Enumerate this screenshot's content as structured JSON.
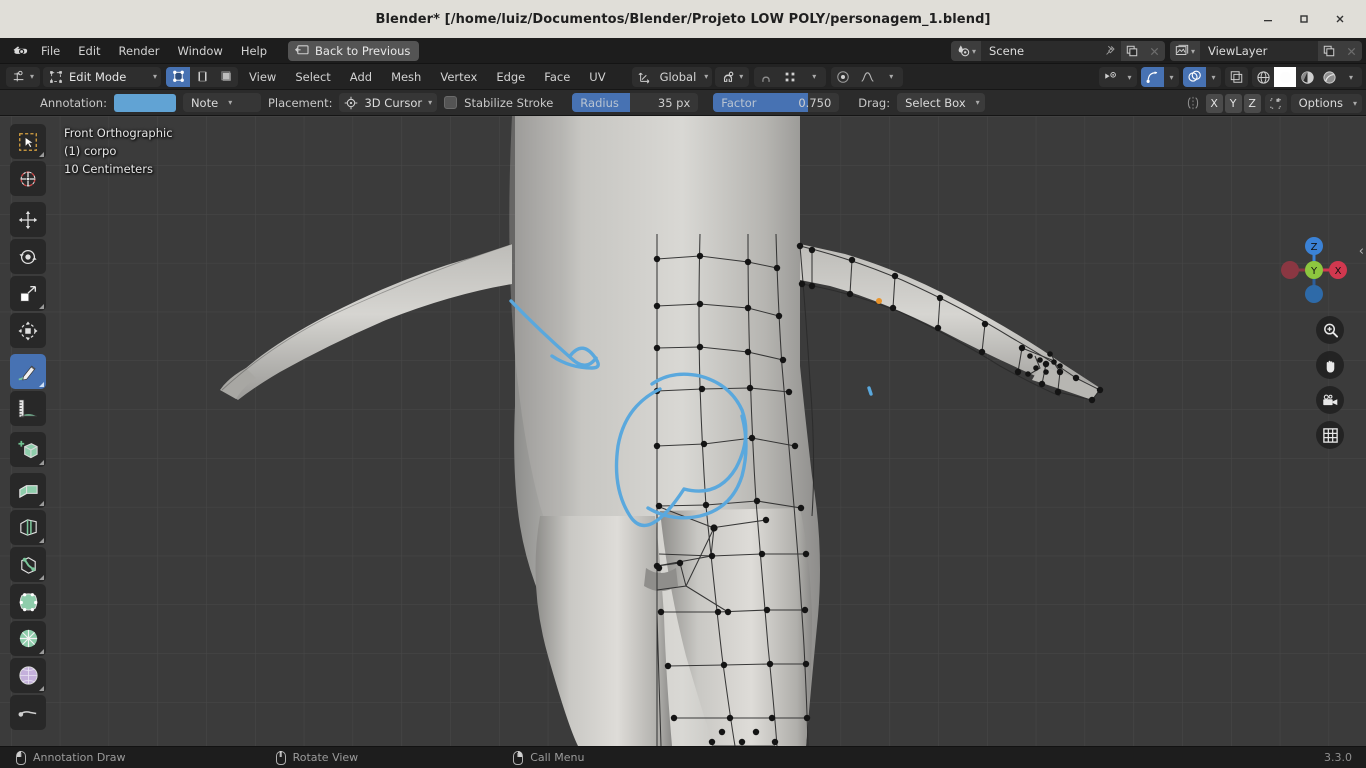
{
  "window": {
    "title": "Blender* [/home/luiz/Documentos/Blender/Projeto LOW POLY/personagem_1.blend]",
    "minimize": "–",
    "maximize": "□",
    "close": "✕"
  },
  "topbar": {
    "logo_icon": "blender-logo-icon",
    "menus": [
      "File",
      "Edit",
      "Render",
      "Window",
      "Help"
    ],
    "back_to_previous": "Back to Previous",
    "back_icon": "back-to-previous-icon",
    "scene": {
      "icon": "scene-datablock-icon",
      "name": "Scene",
      "pin_icon": "pin-icon",
      "copy_icon": "new-scene-icon",
      "close_icon": "unlink-scene-icon"
    },
    "viewlayer": {
      "icon": "viewlayer-datablock-icon",
      "name": "ViewLayer",
      "copy_icon": "new-viewlayer-icon",
      "close_icon": "remove-viewlayer-icon"
    }
  },
  "viewheader": {
    "editor_type_icon": "editor-type-icon",
    "mode": "Edit Mode",
    "mode_icon": "edit-mode-icon",
    "select_modes": [
      "vertex-select-icon",
      "edge-select-icon",
      "face-select-icon"
    ],
    "active_select_mode": 0,
    "menus": [
      "View",
      "Select",
      "Add",
      "Mesh",
      "Vertex",
      "Edge",
      "Face",
      "UV"
    ],
    "transform_orientation": "Global",
    "transform_orientation_icon": "orientation-gizmo-icon",
    "snap_icon": "snap-magnet-icon",
    "snap_target_icon": "snap-increment-icon",
    "proportional_icon": "proportional-editing-icon",
    "falloff_icon": "proportional-falloff-icon",
    "visibility_icon": "object-visibility-icon",
    "gizmo_icon": "show-gizmo-icon",
    "overlays_icon": "show-overlays-icon",
    "xray_icon": "toggle-xray-icon",
    "shading_modes": [
      "wireframe-shading-icon",
      "solid-shading-icon",
      "material-preview-icon",
      "rendered-shading-icon"
    ],
    "active_shading": 1
  },
  "toolsettings": {
    "annotation_label": "Annotation:",
    "annotation_color": "#61a3d4",
    "layer_name": "Note",
    "placement_label": "Placement:",
    "placement_icon": "3d-cursor-icon",
    "placement_value": "3D Cursor",
    "stabilize_label": "Stabilize Stroke",
    "stabilize_checked": false,
    "radius_label": "Radius",
    "radius_value": "35 px",
    "radius_fill_pct": 46,
    "factor_label": "Factor",
    "factor_value": "0.750",
    "factor_fill_pct": 75,
    "drag_label": "Drag:",
    "drag_value": "Select Box",
    "mirror_icon": "mirror-icon",
    "axes": [
      "X",
      "Y",
      "Z"
    ],
    "snap_view_icon": "snap-to-view-icon",
    "options": "Options"
  },
  "viewport": {
    "view_name": "Front Orthographic",
    "collection_object": "(1) corpo",
    "grid_scale": "10 Centimeters",
    "background_color": "#3b3b3b",
    "annotation_stroke_color": "#5aa8dd",
    "toolbar": [
      {
        "name": "tweak-select-box-tool",
        "icon": "select-box-icon",
        "active": false,
        "group": 0
      },
      {
        "name": "cursor-tool",
        "icon": "3d-cursor-tool-icon",
        "active": false,
        "group": 0
      },
      {
        "name": "move-tool",
        "icon": "move-tool-icon",
        "active": false,
        "group": 1
      },
      {
        "name": "rotate-tool",
        "icon": "rotate-tool-icon",
        "active": false,
        "group": 1
      },
      {
        "name": "scale-tool",
        "icon": "scale-tool-icon",
        "active": false,
        "group": 1
      },
      {
        "name": "transform-tool",
        "icon": "transform-tool-icon",
        "active": false,
        "group": 1
      },
      {
        "name": "annotate-tool",
        "icon": "annotate-pencil-icon",
        "active": true,
        "group": 2
      },
      {
        "name": "measure-tool",
        "icon": "measure-ruler-icon",
        "active": false,
        "group": 2
      },
      {
        "name": "add-cube-tool",
        "icon": "add-cube-icon",
        "active": false,
        "group": 3
      },
      {
        "name": "extrude-region-tool",
        "icon": "extrude-region-icon",
        "active": false,
        "group": 4
      },
      {
        "name": "inset-faces-tool",
        "icon": "inset-faces-icon",
        "active": false,
        "group": 4
      },
      {
        "name": "bevel-tool",
        "icon": "bevel-icon",
        "active": false,
        "group": 4
      },
      {
        "name": "loop-cut-tool",
        "icon": "loop-cut-icon",
        "active": false,
        "group": 4
      },
      {
        "name": "knife-tool",
        "icon": "knife-icon",
        "active": false,
        "group": 4
      },
      {
        "name": "poly-build-tool",
        "icon": "poly-build-icon",
        "active": false,
        "group": 5
      },
      {
        "name": "spin-tool",
        "icon": "spin-icon",
        "active": false,
        "group": 5
      },
      {
        "name": "smooth-tool",
        "icon": "smooth-sphere-icon",
        "active": false,
        "group": 6
      },
      {
        "name": "shrink-fatten-tool",
        "icon": "shrink-fatten-icon",
        "active": false,
        "group": 6
      }
    ],
    "gizmo": {
      "z_label": "Z",
      "y_label": "Y",
      "x_label": "X",
      "z_color": "#3b82d6",
      "y_color": "#8dc63f",
      "x_color": "#d1384f"
    },
    "nav_buttons": [
      "zoom-icon",
      "pan-hand-icon",
      "camera-view-icon",
      "toggle-ortho-grid-icon"
    ],
    "sidebar_toggle_icon": "sidebar-toggle-icon"
  },
  "statusbar": {
    "items": [
      {
        "icon": "mouse-left-icon",
        "label": "Annotation Draw"
      },
      {
        "icon": "mouse-middle-icon",
        "label": "Rotate View"
      },
      {
        "icon": "mouse-right-icon",
        "label": "Call Menu"
      }
    ],
    "version": "3.3.0"
  }
}
